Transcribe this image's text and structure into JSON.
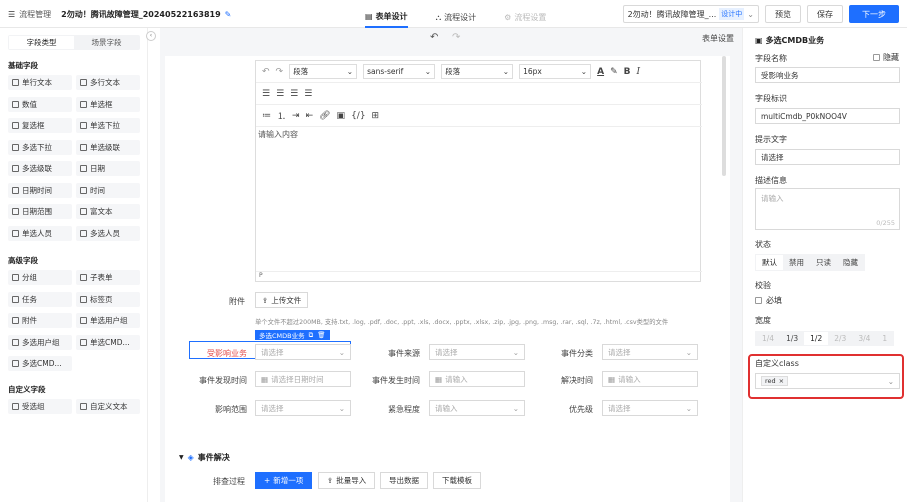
{
  "topbar": {
    "breadcrumb": "流程管理",
    "title": "2勿动！腾讯故障管理_20240522163819",
    "tabs": [
      {
        "label": "表单设计",
        "state": "active"
      },
      {
        "label": "流程设计",
        "state": "normal"
      },
      {
        "label": "流程设置",
        "state": "disabled"
      }
    ],
    "selector_value": "2勿动！腾讯故障管理_...",
    "selector_badge": "设计中",
    "preview_label": "预览",
    "save_label": "保存",
    "next_label": "下一步",
    "accent_color": "#1e6fff"
  },
  "left_panel": {
    "tab_field_types": "字段类型",
    "tab_scene_fields": "场景字段",
    "sections": [
      {
        "title": "基础字段",
        "items": [
          "单行文本",
          "多行文本",
          "数值",
          "单选框",
          "复选框",
          "单选下拉",
          "多选下拉",
          "单选级联",
          "多选级联",
          "日期",
          "日期时间",
          "时间",
          "日期范围",
          "富文本",
          "单选人员",
          "多选人员"
        ]
      },
      {
        "title": "高级字段",
        "items": [
          "分组",
          "子表单",
          "任务",
          "标签页",
          "附件",
          "单选用户组",
          "多选用户组",
          "单选CMD...",
          "多选CMD..."
        ]
      },
      {
        "title": "自定义字段",
        "items": [
          "受选组",
          "自定义文本"
        ]
      }
    ]
  },
  "center": {
    "form_settings": "表单设置",
    "editor": {
      "paragraph_1": "段落",
      "font": "sans-serif",
      "paragraph_2": "段落",
      "size": "16px",
      "placeholder": "请输入内容",
      "footer": "P"
    },
    "attachment_label": "附件",
    "upload_label": "上传文件",
    "upload_tip": "单个文件不超过200MB, 支持.txt, .log, .pdf, .doc, .ppt, .xls, .docx, .pptx, .xlsx, .zip, .jpg, .png, .msg, .rar, .sql, .7z, .html, .csv类型的文件",
    "selected_tag": "多选CMDB业务",
    "rows": [
      [
        {
          "label": "受影响业务",
          "placeholder": "请选择",
          "type": "select"
        },
        {
          "label": "事件来源",
          "placeholder": "请选择",
          "type": "select"
        },
        {
          "label": "事件分类",
          "placeholder": "请选择",
          "type": "select"
        }
      ],
      [
        {
          "label": "事件发现时间",
          "placeholder": "请选择日期时间",
          "type": "date"
        },
        {
          "label": "事件发生时间",
          "placeholder": "请输入",
          "type": "date"
        },
        {
          "label": "解决时间",
          "placeholder": "请输入",
          "type": "date"
        }
      ],
      [
        {
          "label": "影响范围",
          "placeholder": "请选择",
          "type": "select"
        },
        {
          "label": "紧急程度",
          "placeholder": "请输入",
          "type": "select"
        },
        {
          "label": "优先级",
          "placeholder": "请选择",
          "type": "select"
        }
      ]
    ],
    "section_title": "事件解决",
    "process_label": "排查过程",
    "buttons": [
      "新增一项",
      "批量导入",
      "导出数据",
      "下载模板"
    ]
  },
  "right_panel": {
    "title": "多选CMDB业务",
    "field_name_label": "字段名称",
    "hide_label": "隐藏",
    "field_name_value": "受影响业务",
    "field_id_label": "字段标识",
    "field_id_value": "multiCmdb_P0kNOO4V",
    "hint_label": "提示文字",
    "hint_value": "请选择",
    "desc_label": "描述信息",
    "desc_placeholder": "请输入",
    "desc_count": "0/255",
    "status_label": "状态",
    "status_options": [
      "默认",
      "禁用",
      "只读",
      "隐藏"
    ],
    "validate_label": "校验",
    "required_label": "必填",
    "width_label": "宽度",
    "width_options": [
      "1/4",
      "1/3",
      "1/2",
      "2/3",
      "3/4",
      "1"
    ],
    "class_label": "自定义class",
    "class_tag": "red"
  }
}
